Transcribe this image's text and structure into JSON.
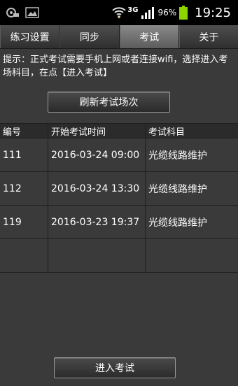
{
  "status_bar": {
    "network": "3G",
    "battery_percent": "96%",
    "time": "19:25",
    "icons": [
      "cloud-icon",
      "image-icon",
      "wifi-icon",
      "signal-icon",
      "battery-icon"
    ]
  },
  "tabs": [
    {
      "label": "练习设置",
      "active": false
    },
    {
      "label": "同步",
      "active": false
    },
    {
      "label": "考试",
      "active": true
    },
    {
      "label": "关于",
      "active": false
    }
  ],
  "hint": "提示：正式考试需要手机上网或者连接wifi，选择进入考场科目，在点【进入考试】",
  "refresh_button": "刷新考试场次",
  "table": {
    "headers": [
      "编号",
      "开始考试时间",
      "考试科目"
    ],
    "rows": [
      [
        "111",
        "2016-03-24 09:00",
        "光缆线路维护"
      ],
      [
        "112",
        "2016-03-24 13:30",
        "光缆线路维护"
      ],
      [
        "119",
        "2016-03-23 19:37",
        "光缆线路维护"
      ],
      [
        "",
        "",
        ""
      ]
    ]
  },
  "enter_button": "进入考试",
  "colors": {
    "background": "#3a3a3a",
    "statusbar": "#000000",
    "battery": "#8fd400"
  }
}
